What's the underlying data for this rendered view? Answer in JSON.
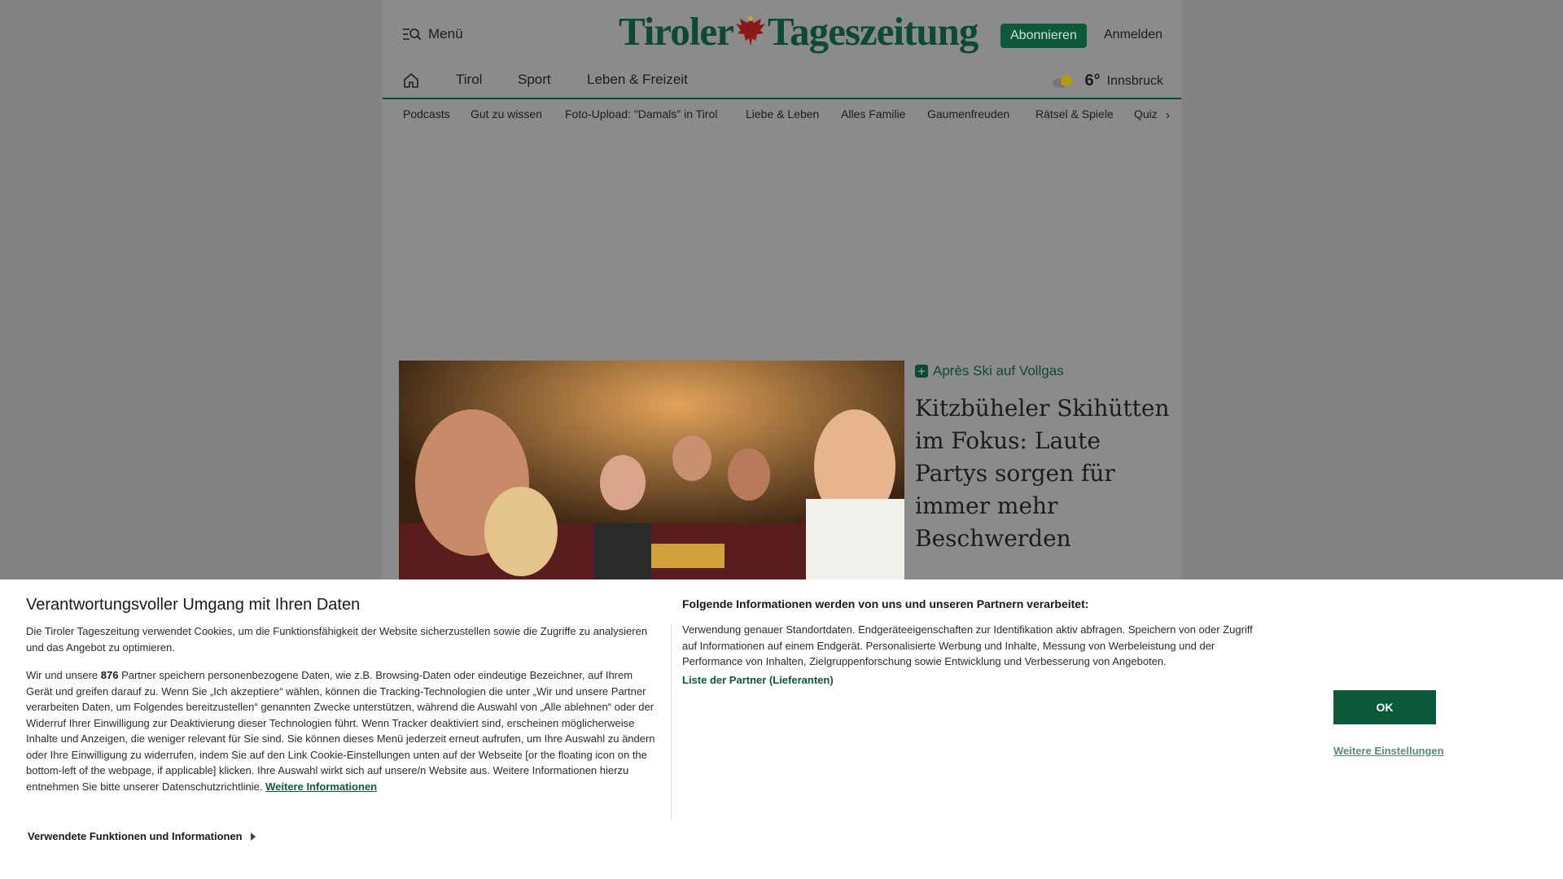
{
  "header": {
    "menu_label": "Menü",
    "logo_left": "Tiroler",
    "logo_right": "Tageszeitung",
    "subscribe_label": "Abonnieren",
    "login_label": "Anmelden"
  },
  "nav": {
    "items": [
      "Tirol",
      "Sport",
      "Leben & Freizeit"
    ],
    "weather": {
      "temp": "6°",
      "location": "Innsbruck"
    }
  },
  "subnav": {
    "items": [
      "Podcasts",
      "Gut zu wissen",
      "Foto-Upload: \"Damals\" in Tirol",
      "Liebe & Leben",
      "Alles Familie",
      "Gaumenfreuden",
      "Rätsel & Spiele",
      "Quiz"
    ]
  },
  "teaser": {
    "kicker": "Après Ski auf Vollgas",
    "headline": "Kitzbüheler Skihütten im Fokus: Laute Partys sorgen für immer mehr Beschwerden"
  },
  "consent": {
    "title": "Verantwortungsvoller Umgang mit Ihren Daten",
    "intro": "Die Tiroler Tageszeitung verwendet Cookies, um die Funktionsfähigkeit der Website sicherzustellen sowie die Zugriffe zu analysieren und das Angebot zu optimieren.",
    "partners_prefix": "Wir und unsere ",
    "partners_count": "876",
    "partners_text": " Partner speichern personenbezogene Daten, wie z.B. Browsing-Daten oder eindeutige Bezeichner, auf Ihrem Gerät und greifen darauf zu. Wenn Sie „Ich akzeptiere“ wählen, können die Tracking-Technologien die unter „Wir und unsere Partner verarbeiten Daten, um Folgendes bereitzustellen“ genannten Zwecke unterstützen, während die Auswahl von „Alle ablehnen“ oder der Widerruf Ihrer Einwilligung zur Deaktivierung dieser Technologien führt. Wenn Tracker deaktiviert sind, erscheinen möglicherweise Inhalte und Anzeigen, die weniger relevant für Sie sind. Sie können dieses Menü jederzeit erneut aufrufen, um Ihre Auswahl zu ändern oder Ihre Einwilligung zu widerrufen, indem Sie auf den Link Cookie-Einstellungen unten auf der Webseite [or the floating icon on the bottom-left of the webpage, if applicable] klicken. Ihre Auswahl wirkt sich auf unsere/n Website aus. Weitere Informationen hierzu entnehmen Sie bitte unserer Datenschutzrichtlinie. ",
    "more_info_link": "Weitere Informationen",
    "right_title": "Folgende Informationen werden von uns und unseren Partnern verarbeitet:",
    "right_text": "Verwendung genauer Standortdaten. Endgeräteeigenschaften zur Identifikation aktiv abfragen. Speichern von oder Zugriff auf Informationen auf einem Endgerät. Personalisierte Werbung und Inhalte, Messung von Werbeleistung und der Performance von Inhalten, Zielgruppenforschung sowie Entwicklung und Verbesserung von Angeboten.",
    "partner_list_link": "Liste der Partner (Lieferanten)",
    "ok_label": "OK",
    "settings_link": "Weitere Einstellungen",
    "details_toggle": "Verwendete Funktionen und Informationen"
  },
  "colors": {
    "brand_green": "#0c5a3a",
    "dim_background": "#838383",
    "banner_background": "#ffffff"
  },
  "icons": [
    "menu-search-icon",
    "eagle-icon",
    "home-icon",
    "weather-sun-cloud-icon",
    "chevron-right-icon",
    "plus-icon",
    "triangle-right-icon"
  ]
}
